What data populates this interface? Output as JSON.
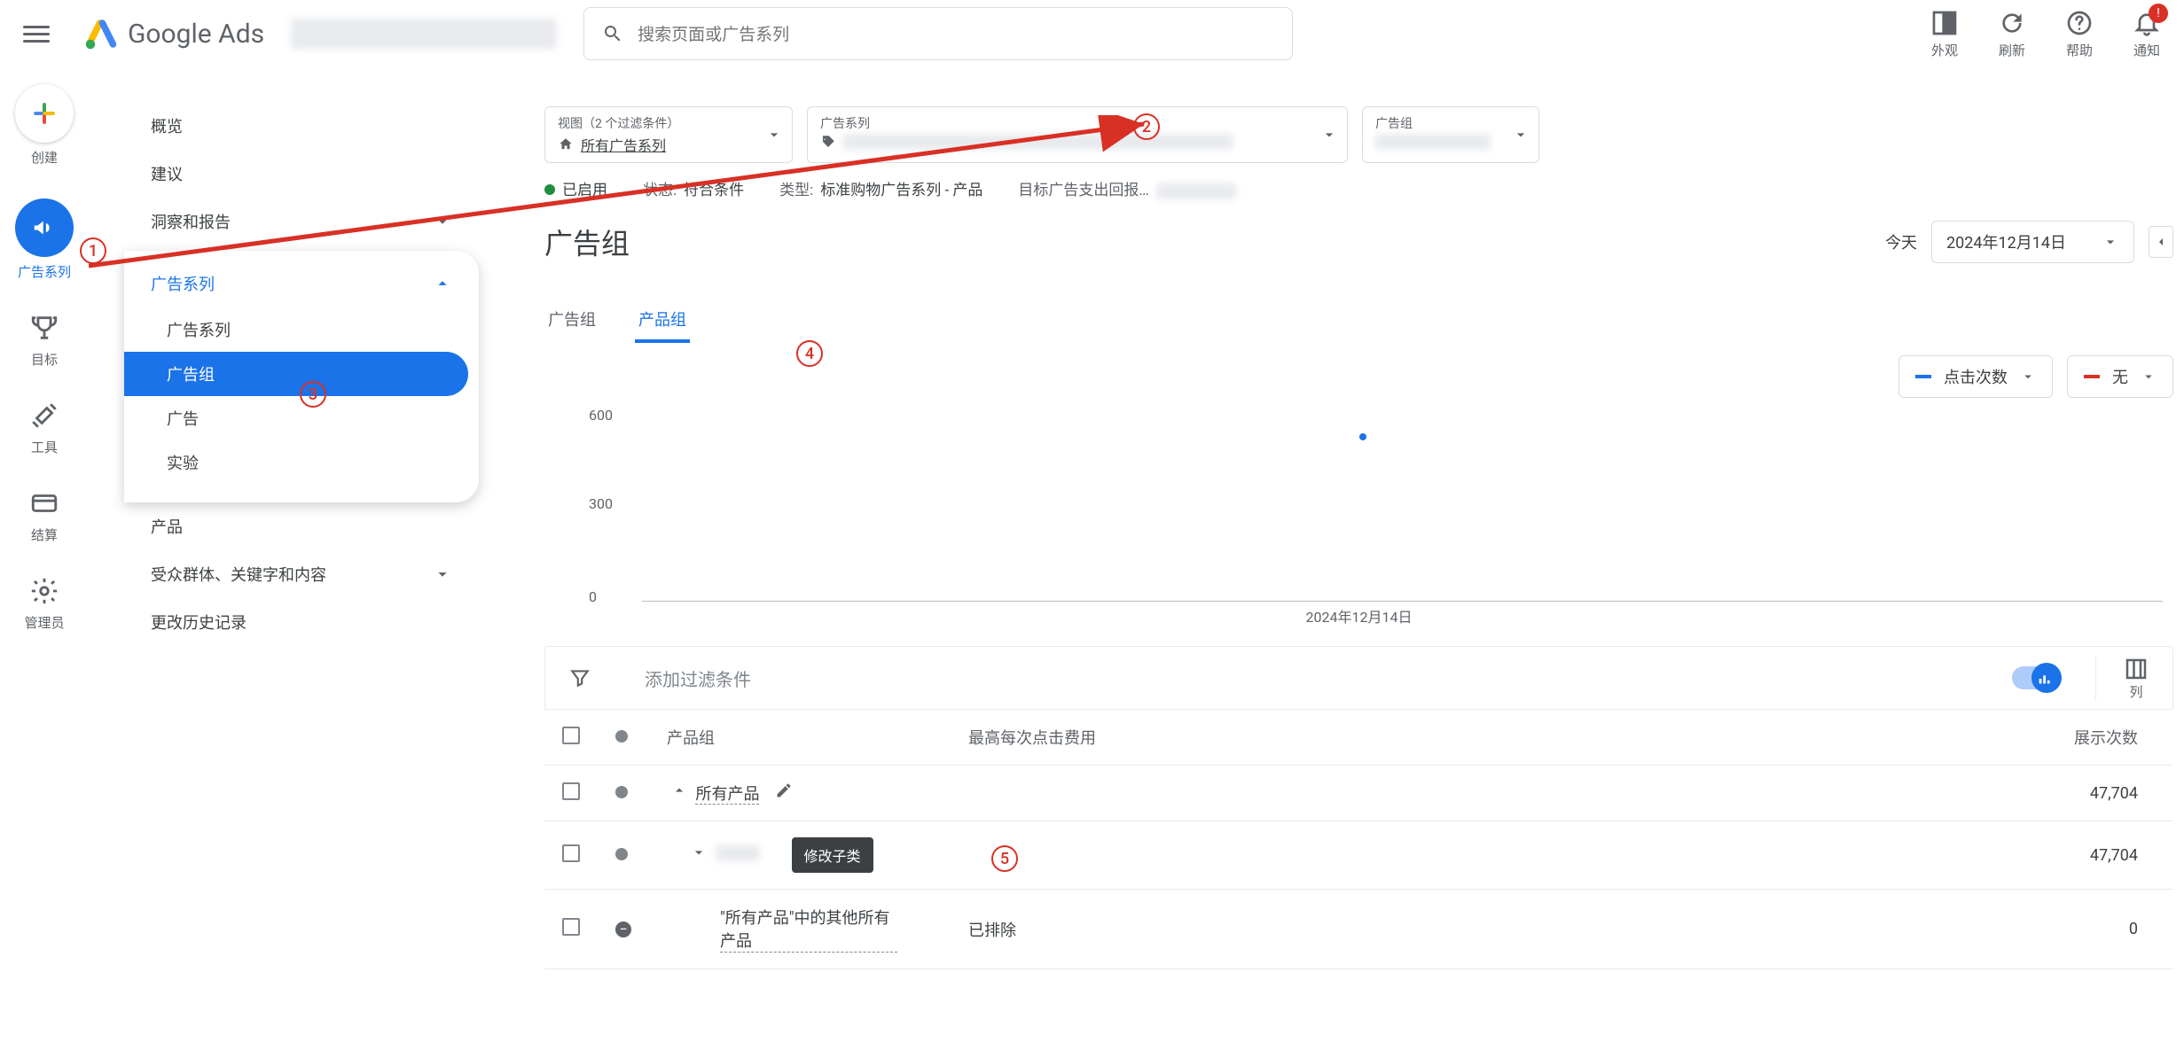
{
  "brand": "Google Ads",
  "search_placeholder": "搜索页面或广告系列",
  "top_actions": {
    "appearance": "外观",
    "refresh": "刷新",
    "help": "帮助",
    "notify": "通知",
    "notify_badge": "!"
  },
  "rail": {
    "create": "创建",
    "campaign": "广告系列",
    "goals": "目标",
    "tools": "工具",
    "billing": "结算",
    "admin": "管理员"
  },
  "nav": {
    "overview": "概览",
    "recs": "建议",
    "insights": "洞察和报告",
    "campaign_parent": "广告系列",
    "campaign": "广告系列",
    "adgroup": "广告组",
    "ads": "广告",
    "experiments": "实验",
    "products": "产品",
    "audiences": "受众群体、关键字和内容",
    "history": "更改历史记录"
  },
  "crumbs": {
    "view_label": "视图（2 个过滤条件）",
    "view_value": "所有广告系列",
    "campaign_label": "广告系列",
    "adgroup_label": "广告组"
  },
  "status_line": {
    "enabled": "已启用",
    "status_k": "状态:",
    "status_v": "符合条件",
    "type_k": "类型:",
    "type_v": "标准购物广告系列 - 产品",
    "roas_k": "目标广告支出回报…"
  },
  "page_title": "广告组",
  "date": {
    "today": "今天",
    "range": "2024年12月14日"
  },
  "tabs": {
    "adgroup": "广告组",
    "product_group": "产品组"
  },
  "metrics": {
    "clicks": "点击次数",
    "none": "无"
  },
  "chart_data": {
    "type": "line",
    "y_ticks": [
      0,
      300,
      600
    ],
    "x_label": "2024年12月14日",
    "series": [
      {
        "name": "点击次数",
        "color": "#1a73e8",
        "values": [
          520
        ]
      }
    ],
    "ylim": [
      0,
      600
    ]
  },
  "filter": {
    "add": "添加过滤条件",
    "columns": "列"
  },
  "table": {
    "headers": {
      "product_group": "产品组",
      "max_cpc": "最高每次点击费用",
      "impressions": "展示次数"
    },
    "rows": [
      {
        "name": "所有产品",
        "expander": "up",
        "pencil": true,
        "cpc": "",
        "impr": "47,704"
      },
      {
        "name": "[blurred]",
        "expander": "down",
        "cpc": "",
        "impr": "47,704"
      },
      {
        "name": "\"所有产品\"中的其他所有产品",
        "status": "minus",
        "cpc": "已排除",
        "impr": "0"
      }
    ],
    "tooltip": "修改子类"
  },
  "annotations": {
    "a1": "1",
    "a2": "2",
    "a3": "3",
    "a4": "4",
    "a5": "5"
  }
}
